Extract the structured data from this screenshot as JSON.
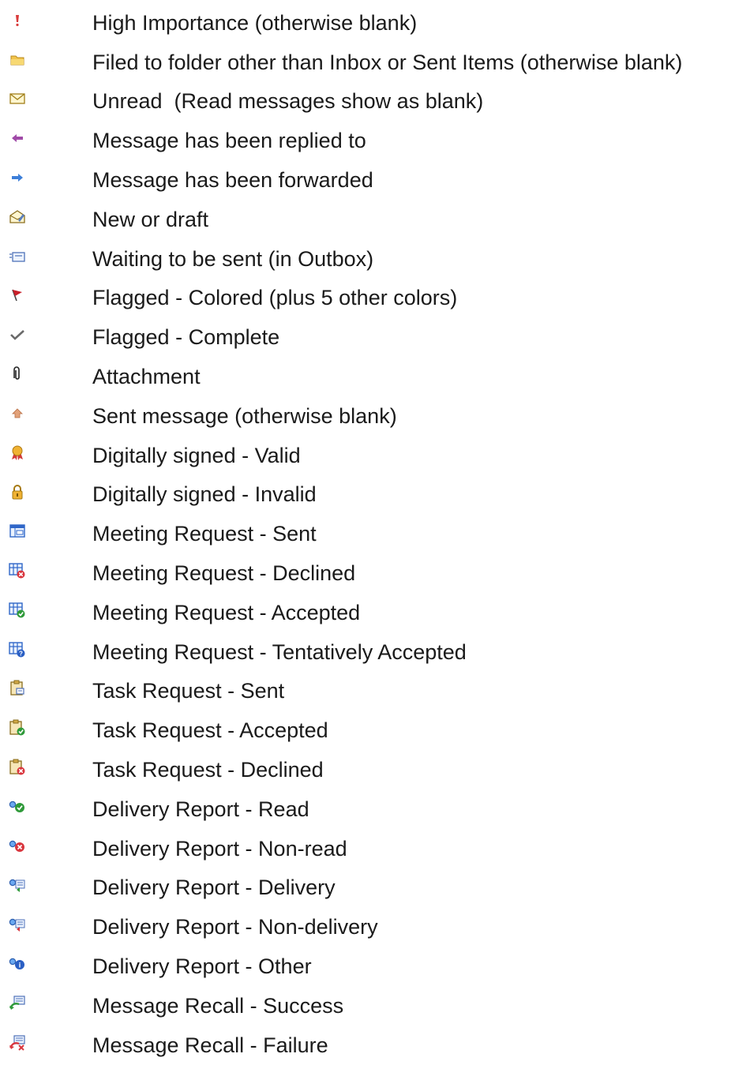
{
  "legend": {
    "rows": [
      {
        "icon": "high-importance-icon",
        "label": "High Importance (otherwise blank)"
      },
      {
        "icon": "folder-icon",
        "label": "Filed to folder other than Inbox or Sent Items (otherwise blank)"
      },
      {
        "icon": "unread-envelope-icon",
        "label": "Unread  (Read messages show as blank)"
      },
      {
        "icon": "replied-arrow-icon",
        "label": "Message has been replied to"
      },
      {
        "icon": "forwarded-arrow-icon",
        "label": "Message has been forwarded"
      },
      {
        "icon": "draft-envelope-icon",
        "label": "New or draft"
      },
      {
        "icon": "outbox-message-icon",
        "label": "Waiting to be sent (in Outbox)"
      },
      {
        "icon": "flag-icon",
        "label": "Flagged - Colored (plus 5 other colors)"
      },
      {
        "icon": "checkmark-icon",
        "label": "Flagged - Complete"
      },
      {
        "icon": "paperclip-icon",
        "label": "Attachment"
      },
      {
        "icon": "sent-message-icon",
        "label": "Sent message (otherwise blank)"
      },
      {
        "icon": "signed-valid-icon",
        "label": "Digitally signed - Valid"
      },
      {
        "icon": "signed-invalid-icon",
        "label": "Digitally signed - Invalid"
      },
      {
        "icon": "meeting-sent-icon",
        "label": "Meeting Request - Sent"
      },
      {
        "icon": "meeting-declined-icon",
        "label": "Meeting Request - Declined"
      },
      {
        "icon": "meeting-accepted-icon",
        "label": "Meeting Request - Accepted"
      },
      {
        "icon": "meeting-tentative-icon",
        "label": "Meeting Request - Tentatively Accepted"
      },
      {
        "icon": "task-sent-icon",
        "label": "Task Request - Sent"
      },
      {
        "icon": "task-accepted-icon",
        "label": "Task Request - Accepted"
      },
      {
        "icon": "task-declined-icon",
        "label": "Task Request - Declined"
      },
      {
        "icon": "report-read-icon",
        "label": "Delivery Report - Read"
      },
      {
        "icon": "report-non-read-icon",
        "label": "Delivery Report - Non-read"
      },
      {
        "icon": "report-delivery-icon",
        "label": "Delivery Report - Delivery"
      },
      {
        "icon": "report-non-delivery-icon",
        "label": "Delivery Report - Non-delivery"
      },
      {
        "icon": "report-other-icon",
        "label": "Delivery Report - Other"
      },
      {
        "icon": "recall-success-icon",
        "label": "Message Recall - Success"
      },
      {
        "icon": "recall-failure-icon",
        "label": "Message Recall - Failure"
      }
    ]
  }
}
